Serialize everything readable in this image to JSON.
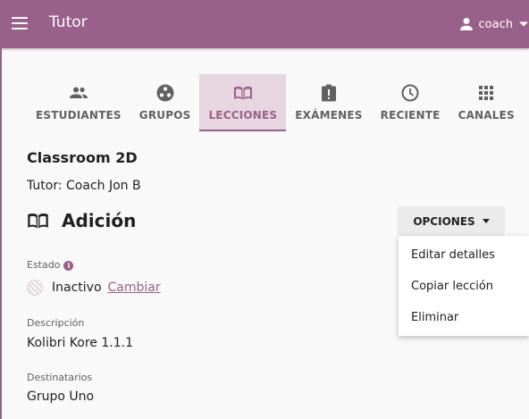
{
  "appbar": {
    "title": "Tutor",
    "user": "coach",
    "color": "#996189"
  },
  "tabs": [
    {
      "label": "ESTUDIANTES",
      "icon": "people-icon",
      "active": false
    },
    {
      "label": "GRUPOS",
      "icon": "groups-icon",
      "active": false
    },
    {
      "label": "LECCIONES",
      "icon": "book-icon",
      "active": true
    },
    {
      "label": "EXÁMENES",
      "icon": "clipboard-icon",
      "active": false
    },
    {
      "label": "RECIENTE",
      "icon": "clock-icon",
      "active": false
    },
    {
      "label": "CANALES",
      "icon": "apps-icon",
      "active": false
    }
  ],
  "main": {
    "classroom": "Classroom 2D",
    "coach": "Tutor: Coach Jon B",
    "lesson_title": "Adición",
    "status_label": "Estado",
    "status_value": "Inactivo",
    "change_link": "Cambiar",
    "description_label": "Descripción",
    "description_value": "Kolibri Kore 1.1.1",
    "recipients_label": "Destinatarios",
    "recipients_value": "Grupo Uno"
  },
  "options": {
    "label": "OPCIONES",
    "items": [
      "Editar detalles",
      "Copiar lección",
      "Eliminar"
    ]
  }
}
